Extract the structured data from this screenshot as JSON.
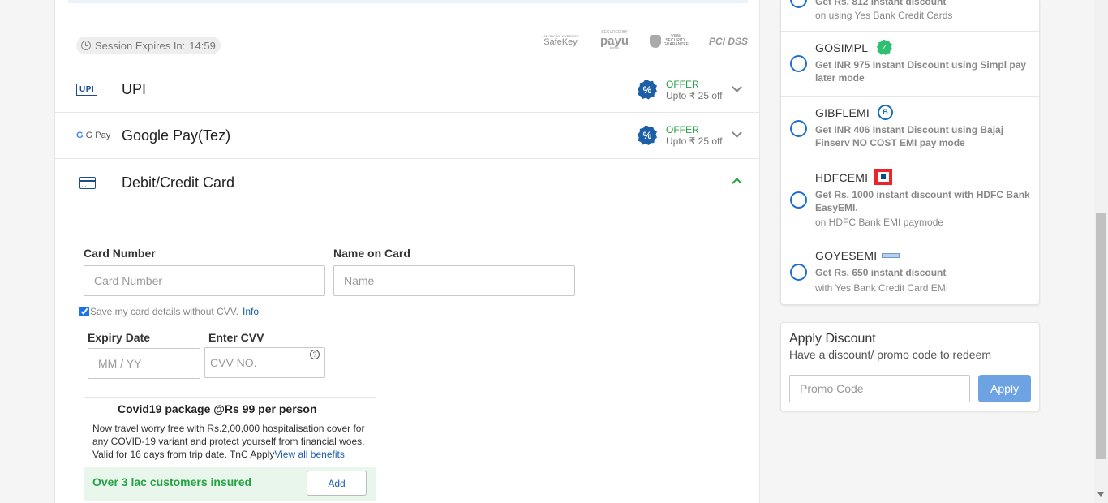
{
  "session": {
    "label": "Session Expires In:",
    "time": "14:59"
  },
  "security_badges": {
    "amex_small": "AMERICAN EXPRESS",
    "amex": "SafeKey",
    "payu_small": "SECURED BY",
    "payu": "payu",
    "payu_sub": "india",
    "secure_guarantee": "100% SECURITY GUARANTEE",
    "pci": "PCI DSS"
  },
  "payment_methods": {
    "upi": {
      "icon": "UPI",
      "title": "UPI",
      "offer_label": "OFFER",
      "offer_amount": "Upto ₹ 25 off"
    },
    "gpay": {
      "icon": "G Pay",
      "title": "Google Pay(Tez)",
      "offer_label": "OFFER",
      "offer_amount": "Upto ₹ 25 off"
    },
    "card": {
      "title": "Debit/Credit Card"
    }
  },
  "card_form": {
    "card_number_label": "Card Number",
    "card_number_placeholder": "Card Number",
    "name_label": "Name on Card",
    "name_placeholder": "Name",
    "save_card_text": "Save my card details without CVV.",
    "save_card_checked": true,
    "info_link": "Info",
    "expiry_label": "Expiry Date",
    "expiry_placeholder": "MM / YY",
    "cvv_label": "Enter CVV",
    "cvv_placeholder": "CVV NO.",
    "cvv_help": "?"
  },
  "covid": {
    "title": "Covid19 package @Rs 99 per person",
    "description": "Now travel worry free with Rs.2,00,000 hospitalisation cover for any COVID-19 variant and protect yourself from financial woes. Valid for 16 days from trip date. TnC Apply",
    "benefits_link": "View all benefits",
    "footer_text": "Over 3 lac customers insured",
    "add_label": "Add"
  },
  "coupons": [
    {
      "code": "",
      "desc": "Get Rs. 812 instant discount",
      "sub": "on using Yes Bank Credit Cards"
    },
    {
      "code": "GOSIMPL",
      "logo": "simpl-icon",
      "desc": "Get INR 975 Instant Discount using Simpl pay later mode",
      "sub": ""
    },
    {
      "code": "GIBFLEMI",
      "logo": "bajaj-finserv-icon",
      "logo_text": "B",
      "desc": "Get INR 406 Instant Discount using Bajaj Finserv NO COST EMI pay mode",
      "sub": ""
    },
    {
      "code": "HDFCEMI",
      "logo": "hdfc-icon",
      "desc": "Get Rs. 1000 instant discount with HDFC Bank EasyEMI.",
      "sub": "on HDFC Bank EMI paymode"
    },
    {
      "code": "GOYESEMI",
      "logo": "yes-bank-icon",
      "desc": "Get Rs. 650 instant discount",
      "sub": "with Yes Bank Credit Card EMI"
    }
  ],
  "apply_discount": {
    "title": "Apply Discount",
    "hint": "Have a discount/ promo code to redeem",
    "placeholder": "Promo Code",
    "button": "Apply"
  },
  "colors": {
    "accent_blue": "#1d5fa6",
    "offer_green": "#25a244",
    "radio_blue": "#1d6fd1",
    "apply_button": "#6da3e3"
  }
}
